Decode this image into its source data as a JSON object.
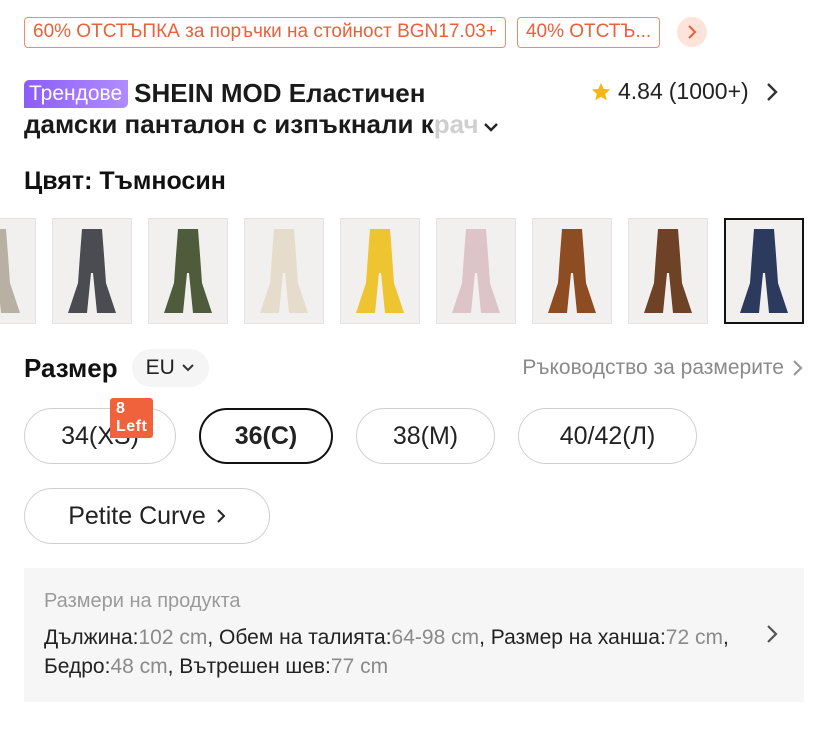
{
  "promos": [
    "60% ОТСТЪПКА за поръчки на стойност BGN17.03+",
    "40% ОТСТЪ..."
  ],
  "product": {
    "trend_badge": "Трендове",
    "title_line1": "SHEIN MOD Еластичен",
    "title_line2_main": "дамски панталон с изпъкнали к",
    "title_line2_fade": "рач",
    "rating": "4.84",
    "reviews": "(1000+)"
  },
  "color": {
    "label": "Цвят: Тъмносин"
  },
  "swatches": [
    {
      "name": "beige-grey",
      "color": "#b9b0a4"
    },
    {
      "name": "charcoal",
      "color": "#4a4c52"
    },
    {
      "name": "olive",
      "color": "#4f5c3c"
    },
    {
      "name": "cream",
      "color": "#e6dccb"
    },
    {
      "name": "yellow",
      "color": "#efc431"
    },
    {
      "name": "pink",
      "color": "#ddc4c8"
    },
    {
      "name": "rust",
      "color": "#8e4c22"
    },
    {
      "name": "brown",
      "color": "#6e4226"
    },
    {
      "name": "navy",
      "color": "#2c3a5e"
    }
  ],
  "size": {
    "label": "Размер",
    "system": "EU",
    "guide": "Ръководство за размерите",
    "badge": "8 Left",
    "options": [
      "34(XS)",
      "36(C)",
      "38(M)",
      "40/42(Л)"
    ],
    "petite": "Petite Curve"
  },
  "measurements": {
    "title": "Размери на продукта",
    "k1": "Дължина:",
    "v1": "102 cm",
    "k2": ", Обем на талията:",
    "v2": "64-98 cm",
    "k3": ", Размер на ханша:",
    "v3": "72 cm",
    "k4": ", Бедро:",
    "v4": "48 cm",
    "k5": ", Вътрешен шев:",
    "v5": "77 cm"
  }
}
